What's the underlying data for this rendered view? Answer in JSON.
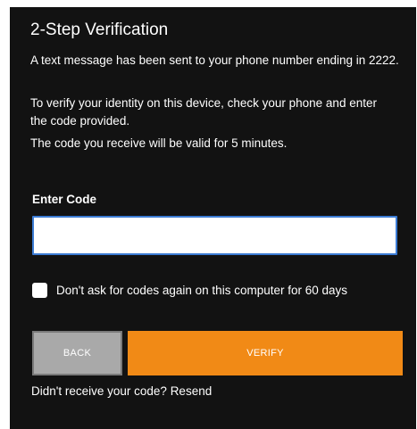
{
  "dialog": {
    "title": "2-Step Verification",
    "message_sent": "A text message has been sent to your phone number ending in 2222.",
    "instructions": "To verify your identity on this device, check your phone and enter the code provided.",
    "validity": "The code you receive will be valid for 5 minutes."
  },
  "code_field": {
    "label": "Enter Code",
    "value": "",
    "placeholder": ""
  },
  "remember_device": {
    "label": "Don't ask for codes again on this computer for 60 days",
    "checked": false
  },
  "buttons": {
    "back_label": "BACK",
    "verify_label": "VERIFY"
  },
  "resend": {
    "prompt": "Didn't receive your code?",
    "link_label": "Resend"
  },
  "colors": {
    "panel_background": "#121212",
    "verify_button": "#f18a16",
    "back_button": "#a9a9a9",
    "input_focus_border": "#3b7bd4"
  }
}
